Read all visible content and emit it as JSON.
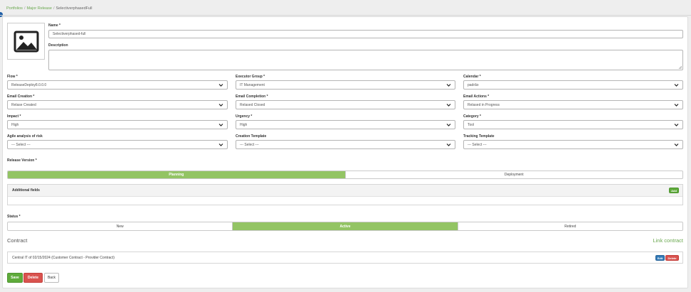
{
  "breadcrumb": {
    "items": [
      "Portfolios",
      "Major Release",
      "SelectiverphasedFull"
    ]
  },
  "name": {
    "label": "Name *",
    "value": "Selectiverphased-full"
  },
  "description": {
    "label": "Description",
    "value": ""
  },
  "fields": {
    "flow": {
      "label": "Flow *",
      "value": "ReleaseDeploy8.0.0.0"
    },
    "executor_group": {
      "label": "Executor Group *",
      "value": "IT Management"
    },
    "calendar": {
      "label": "Calendar *",
      "value": "padrão"
    },
    "email_creation": {
      "label": "Email Creation *",
      "value": "Relase Created"
    },
    "email_completion": {
      "label": "Email Completion *",
      "value": "Relased Closed"
    },
    "email_actions": {
      "label": "Email Actions *",
      "value": "Relased in Progress"
    },
    "impact": {
      "label": "Impact *",
      "value": "High"
    },
    "urgency": {
      "label": "Urgency *",
      "value": "High"
    },
    "category": {
      "label": "Category *",
      "value": "Tool"
    },
    "agile_analysis": {
      "label": "Agile analysis of risk",
      "value": "--- Select ---"
    },
    "creation_template": {
      "label": "Creation Template",
      "value": "--- Select ---"
    },
    "tracking_template": {
      "label": "Tracking Template",
      "value": "--- Select ---"
    }
  },
  "release_version": {
    "label": "Release Version *",
    "options": [
      "Planning",
      "Deployment"
    ],
    "selected": "Planning"
  },
  "additional_fields": {
    "title": "Additional fields",
    "add_label": "Add"
  },
  "status": {
    "label": "Status *",
    "options": [
      "New",
      "Active",
      "Retired"
    ],
    "selected": "Active"
  },
  "contract": {
    "title": "Contract",
    "link_label": "Link contract",
    "row_text": "Central IT of 02/15/2024 (Customer Contract - Provider Contract)",
    "edit_label": "Edit",
    "delete_label": "Delete"
  },
  "actions": {
    "save": "Save",
    "delete": "Delete",
    "back": "Back"
  },
  "colors": {
    "accent_green": "#93c464",
    "button_green": "#5fab3b",
    "danger": "#d9534f",
    "primary": "#337ab7",
    "link_green": "#6aa84f"
  },
  "icons": {
    "image_placeholder": "image-icon",
    "select_arrow": "chevron-down-icon"
  }
}
